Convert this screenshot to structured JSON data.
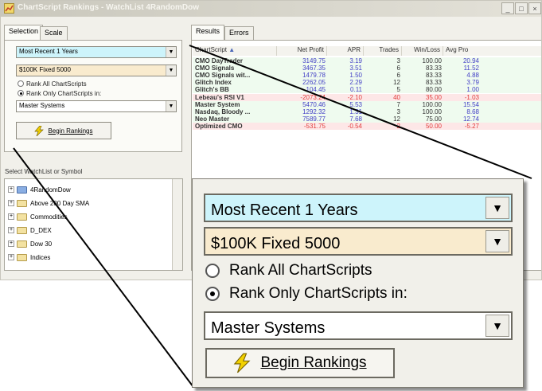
{
  "window": {
    "title": "ChartScript Rankings - WatchList 4RandomDow",
    "buttons": [
      "_",
      "□",
      "×"
    ]
  },
  "left_tabs": [
    "Selection",
    "Scale"
  ],
  "selection": {
    "period_value": "Most Recent 1 Years",
    "sizing_value": "$100K Fixed 5000",
    "radio_all": "Rank All ChartScripts",
    "radio_only": "Rank Only ChartScripts in:",
    "radio_selected": "only",
    "folder_value": "Master Systems",
    "begin_button": "Begin Rankings"
  },
  "watchlist": {
    "label": "Select WatchList or Symbol",
    "items": [
      "4RandomDow",
      "Above 200 Day SMA",
      "Commodities",
      "D_DEX",
      "Dow 30",
      "Indices"
    ]
  },
  "right_tabs": [
    "Results",
    "Errors"
  ],
  "results": {
    "columns": [
      "ChartScript",
      "Net Profit",
      "APR",
      "Trades",
      "Win/Loss",
      "Avg Pro"
    ],
    "sort_indicator": "▲",
    "rows": [
      {
        "name": "CMO DayTrader",
        "net": "3149.75",
        "apr": "3.19",
        "trades": "3",
        "wl": "100.00",
        "avg": "20.94",
        "neg": false
      },
      {
        "name": "CMO Signals",
        "net": "3467.35",
        "apr": "3.51",
        "trades": "6",
        "wl": "83.33",
        "avg": "11.52",
        "neg": false
      },
      {
        "name": "CMO Signals wit...",
        "net": "1479.78",
        "apr": "1.50",
        "trades": "6",
        "wl": "83.33",
        "avg": "4.88",
        "neg": false
      },
      {
        "name": "Glitch Index",
        "net": "2262.05",
        "apr": "2.29",
        "trades": "12",
        "wl": "83.33",
        "avg": "3.79",
        "neg": false
      },
      {
        "name": "Glitch's BB",
        "net": "104.45",
        "apr": "0.11",
        "trades": "5",
        "wl": "80.00",
        "avg": "1.00",
        "neg": false
      },
      {
        "name": "Lebeau's RSI V1",
        "net": "-2073.24",
        "apr": "-2.10",
        "trades": "40",
        "wl": "35.00",
        "avg": "-1.03",
        "neg": true
      },
      {
        "name": "Master System",
        "net": "5470.46",
        "apr": "5.53",
        "trades": "7",
        "wl": "100.00",
        "avg": "15.54",
        "neg": false
      },
      {
        "name": "Nasdaq, Bloody ...",
        "net": "1292.32",
        "apr": "1.31",
        "trades": "3",
        "wl": "100.00",
        "avg": "8.68",
        "neg": false
      },
      {
        "name": "Neo Master",
        "net": "7589.77",
        "apr": "7.68",
        "trades": "12",
        "wl": "75.00",
        "avg": "12.74",
        "neg": false
      },
      {
        "name": "Optimized CMO",
        "net": "-531.75",
        "apr": "-0.54",
        "trades": "2",
        "wl": "50.00",
        "avg": "-5.27",
        "neg": true
      }
    ]
  },
  "colors": {
    "period_bg": "#cdf4fb",
    "sizing_bg": "#f9ebce",
    "positive_row_bg": "#effbef",
    "negative_row_bg": "#fde7e7",
    "lightning": "#f2d100"
  },
  "icons": [
    "app-chart-icon",
    "lightning-icon",
    "folder-icon",
    "dropdown-arrow-icon"
  ]
}
